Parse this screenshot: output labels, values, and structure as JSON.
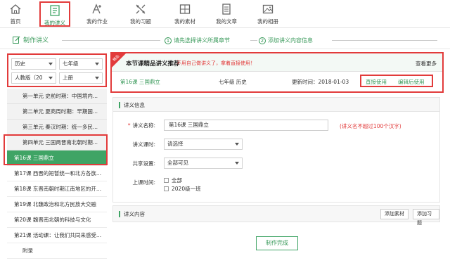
{
  "nav": [
    {
      "label": "首页",
      "icon": "home-icon"
    },
    {
      "label": "我的讲义",
      "icon": "lecture-notes-icon"
    },
    {
      "label": "我的作业",
      "icon": "homework-icon"
    },
    {
      "label": "我的习题",
      "icon": "exercises-icon"
    },
    {
      "label": "我的素材",
      "icon": "materials-icon"
    },
    {
      "label": "我的文章",
      "icon": "articles-icon"
    },
    {
      "label": "我的相册",
      "icon": "album-icon"
    }
  ],
  "subbar": {
    "make": "制作讲义",
    "step1_num": "1",
    "step1": "请先选择讲义所属章节",
    "step2_num": "2",
    "step2": "添加讲义内容信息"
  },
  "filters": {
    "subject": "历史",
    "grade": "七年级",
    "edition": "人教版（20",
    "volume": "上册"
  },
  "units": [
    "第一单元 史前时期：中国境内...",
    "第二单元 夏商周时期：早期国...",
    "第三单元 秦汉时期：统一多民...",
    "第四单元 三国两晋南北朝时期..."
  ],
  "lessons": [
    "第16课 三国鼎立",
    "第17课 西晋的短暂统一和北方各族...",
    "第18课 东晋南朝时期江南地区的开...",
    "第19课 北魏政治和北方民族大交融",
    "第20课 魏晋南北朝的科技与文化",
    "第21课 活动课：让我们共同来感受...",
    "附录"
  ],
  "recommend": {
    "ribbon": "精品",
    "title": "本节课精品讲义推荐",
    "note": "不用自己做讲义了，拿着直接使用！",
    "more": "查看更多",
    "lesson": "第16课 三国鼎立",
    "grade": "七年级 历史",
    "time_label": "更新时间：",
    "time_value": "2018-01-03",
    "direct_use": "直接使用",
    "edit_use": "编辑后使用"
  },
  "info": {
    "section": "讲义信息",
    "name_label": "讲义名称:",
    "name_value": "第16课 三国鼎立",
    "name_hint": "(讲义名不超过100个汉字)",
    "hours_label": "讲义课时:",
    "hours_value": "请选择",
    "share_label": "共享设置:",
    "share_value": "全部可见",
    "class_label": "上课时间:",
    "class_opt1": "全部",
    "class_opt2": "2020级一班"
  },
  "content": {
    "section": "讲义内容",
    "add_material": "添加素材",
    "add_exercise": "添加习题"
  },
  "finish": "制作完成",
  "colors": {
    "accent": "#3fa465",
    "highlight": "#e23b3b"
  }
}
